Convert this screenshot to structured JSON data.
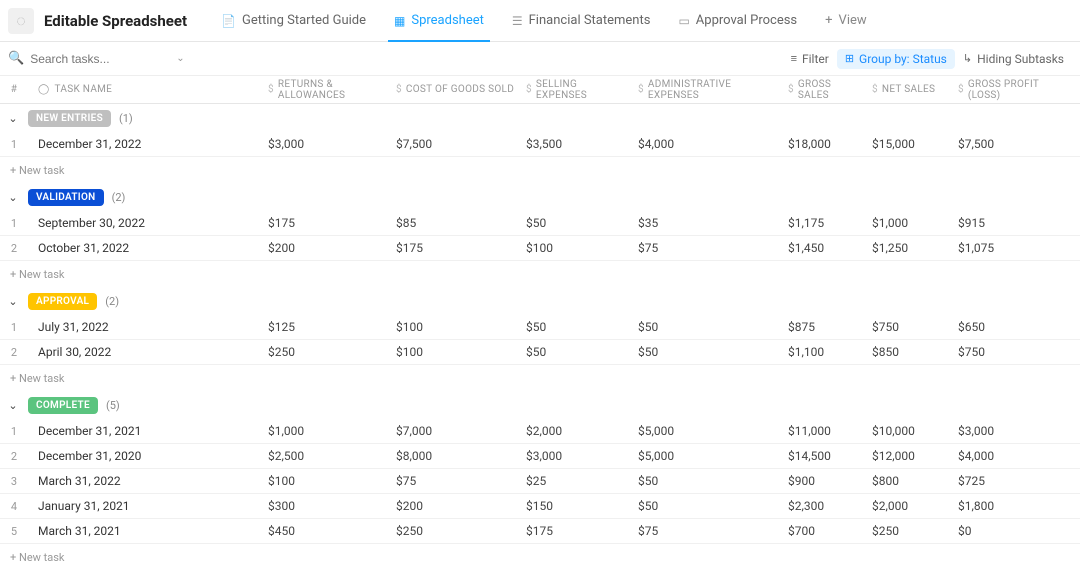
{
  "header": {
    "title": "Editable Spreadsheet",
    "tabs": [
      {
        "label": "Getting Started Guide"
      },
      {
        "label": "Spreadsheet"
      },
      {
        "label": "Financial Statements"
      },
      {
        "label": "Approval Process"
      }
    ],
    "add_view": "View"
  },
  "toolbar": {
    "search_placeholder": "Search tasks...",
    "filter": "Filter",
    "group_by": "Group by: Status",
    "hiding": "Hiding Subtasks"
  },
  "columns": {
    "num": "#",
    "task": "TASK NAME",
    "c1": "RETURNS & ALLOWANCES",
    "c2": "COST OF GOODS SOLD",
    "c3": "SELLING EXPENSES",
    "c4": "ADMINISTRATIVE EXPENSES",
    "c5": "GROSS SALES",
    "c6": "NET SALES",
    "c7": "GROSS PROFIT (LOSS)"
  },
  "groups": [
    {
      "name": "NEW ENTRIES",
      "color": "grey",
      "count": "(1)",
      "rows": [
        {
          "n": "1",
          "task": "December 31, 2022",
          "c1": "$3,000",
          "c2": "$7,500",
          "c3": "$3,500",
          "c4": "$4,000",
          "c5": "$18,000",
          "c6": "$15,000",
          "c7": "$7,500"
        }
      ]
    },
    {
      "name": "VALIDATION",
      "color": "blue",
      "count": "(2)",
      "rows": [
        {
          "n": "1",
          "task": "September 30, 2022",
          "c1": "$175",
          "c2": "$85",
          "c3": "$50",
          "c4": "$35",
          "c5": "$1,175",
          "c6": "$1,000",
          "c7": "$915"
        },
        {
          "n": "2",
          "task": "October 31, 2022",
          "c1": "$200",
          "c2": "$175",
          "c3": "$100",
          "c4": "$75",
          "c5": "$1,450",
          "c6": "$1,250",
          "c7": "$1,075"
        }
      ]
    },
    {
      "name": "APPROVAL",
      "color": "yellow",
      "count": "(2)",
      "rows": [
        {
          "n": "1",
          "task": "July 31, 2022",
          "c1": "$125",
          "c2": "$100",
          "c3": "$50",
          "c4": "$50",
          "c5": "$875",
          "c6": "$750",
          "c7": "$650"
        },
        {
          "n": "2",
          "task": "April 30, 2022",
          "c1": "$250",
          "c2": "$100",
          "c3": "$50",
          "c4": "$50",
          "c5": "$1,100",
          "c6": "$850",
          "c7": "$750"
        }
      ]
    },
    {
      "name": "COMPLETE",
      "color": "green",
      "count": "(5)",
      "rows": [
        {
          "n": "1",
          "task": "December 31, 2021",
          "c1": "$1,000",
          "c2": "$7,000",
          "c3": "$2,000",
          "c4": "$5,000",
          "c5": "$11,000",
          "c6": "$10,000",
          "c7": "$3,000"
        },
        {
          "n": "2",
          "task": "December 31, 2020",
          "c1": "$2,500",
          "c2": "$8,000",
          "c3": "$3,000",
          "c4": "$5,000",
          "c5": "$14,500",
          "c6": "$12,000",
          "c7": "$4,000"
        },
        {
          "n": "3",
          "task": "March 31, 2022",
          "c1": "$100",
          "c2": "$75",
          "c3": "$25",
          "c4": "$50",
          "c5": "$900",
          "c6": "$800",
          "c7": "$725"
        },
        {
          "n": "4",
          "task": "January 31, 2021",
          "c1": "$300",
          "c2": "$200",
          "c3": "$150",
          "c4": "$50",
          "c5": "$2,300",
          "c6": "$2,000",
          "c7": "$1,800"
        },
        {
          "n": "5",
          "task": "March 31, 2021",
          "c1": "$450",
          "c2": "$250",
          "c3": "$175",
          "c4": "$75",
          "c5": "$700",
          "c6": "$250",
          "c7": "$0"
        }
      ]
    }
  ],
  "new_task": "+ New task"
}
